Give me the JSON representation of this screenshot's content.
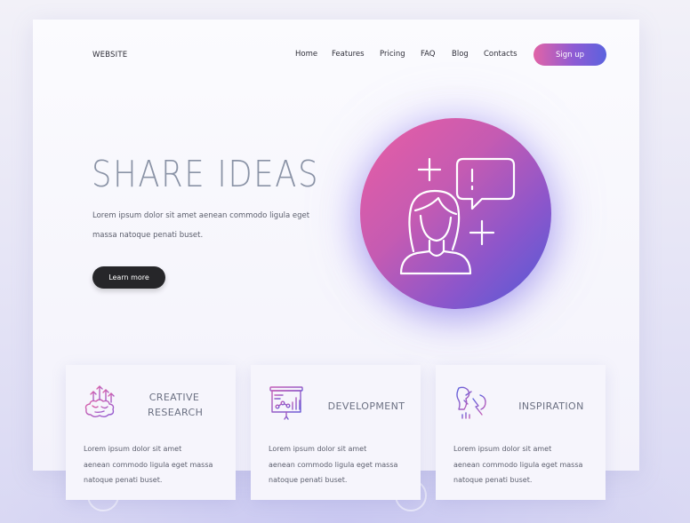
{
  "header": {
    "logo": "WEBSITE",
    "nav": [
      "Home",
      "Features",
      "Pricing",
      "FAQ",
      "Blog",
      "Contacts"
    ],
    "signup_label": "Sign up"
  },
  "hero": {
    "title": "SHARE IDEAS",
    "text_line1": "Lorem ipsum dolor sit amet aenean commodo ligula eget",
    "text_line2": "massa natoque penati buset.",
    "button_label": "Learn more",
    "icon": "woman-speech-bubble-icon"
  },
  "cards": [
    {
      "title_line1": "CREATIVE",
      "title_line2": "RESEARCH",
      "icon": "brain-arrows-icon",
      "text": [
        "Lorem ipsum dolor sit amet",
        "aenean commodo ligula eget massa",
        "natoque penati buset."
      ]
    },
    {
      "title_line1": "DEVELOPMENT",
      "title_line2": "",
      "icon": "presentation-chart-icon",
      "text": [
        "Lorem ipsum dolor sit amet",
        "aenean commodo ligula eget massa",
        "natoque penati buset."
      ]
    },
    {
      "title_line1": "INSPIRATION",
      "title_line2": "",
      "icon": "head-lightning-icon",
      "text": [
        "Lorem ipsum dolor sit amet",
        "aenean commodo ligula eget massa",
        "natoque penati buset."
      ]
    }
  ],
  "colors": {
    "accent_pink": "#e163a6",
    "accent_blue": "#5b62de",
    "dark_button": "#262629",
    "title_gray": "#8a93a6"
  }
}
